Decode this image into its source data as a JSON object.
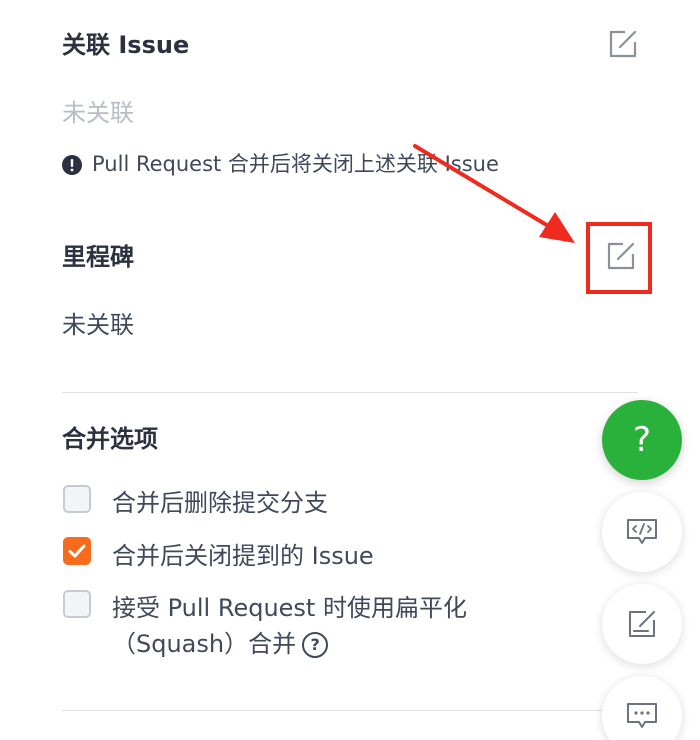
{
  "linked_issue": {
    "title": "关联 Issue",
    "value": "未关联",
    "notice": "Pull Request 合并后将关闭上述关联 Issue"
  },
  "milestone": {
    "title": "里程碑",
    "value": "未关联"
  },
  "merge_options": {
    "title": "合并选项",
    "options": [
      {
        "label": "合并后删除提交分支",
        "checked": false
      },
      {
        "label": "合并后关闭提到的 Issue",
        "checked": true
      },
      {
        "label_line1": "接受 Pull Request 时使用扁平化",
        "label_line2": "（Squash）合并",
        "checked": false
      }
    ]
  },
  "fab": {
    "help_label": "?",
    "icons": [
      "question-icon",
      "code-icon",
      "edit-note-icon",
      "comment-icon"
    ]
  },
  "colors": {
    "accent_orange": "#f76b1c",
    "help_green": "#2ab13b",
    "annotation_red": "#ee2b1e",
    "muted": "#b7bcc5"
  }
}
